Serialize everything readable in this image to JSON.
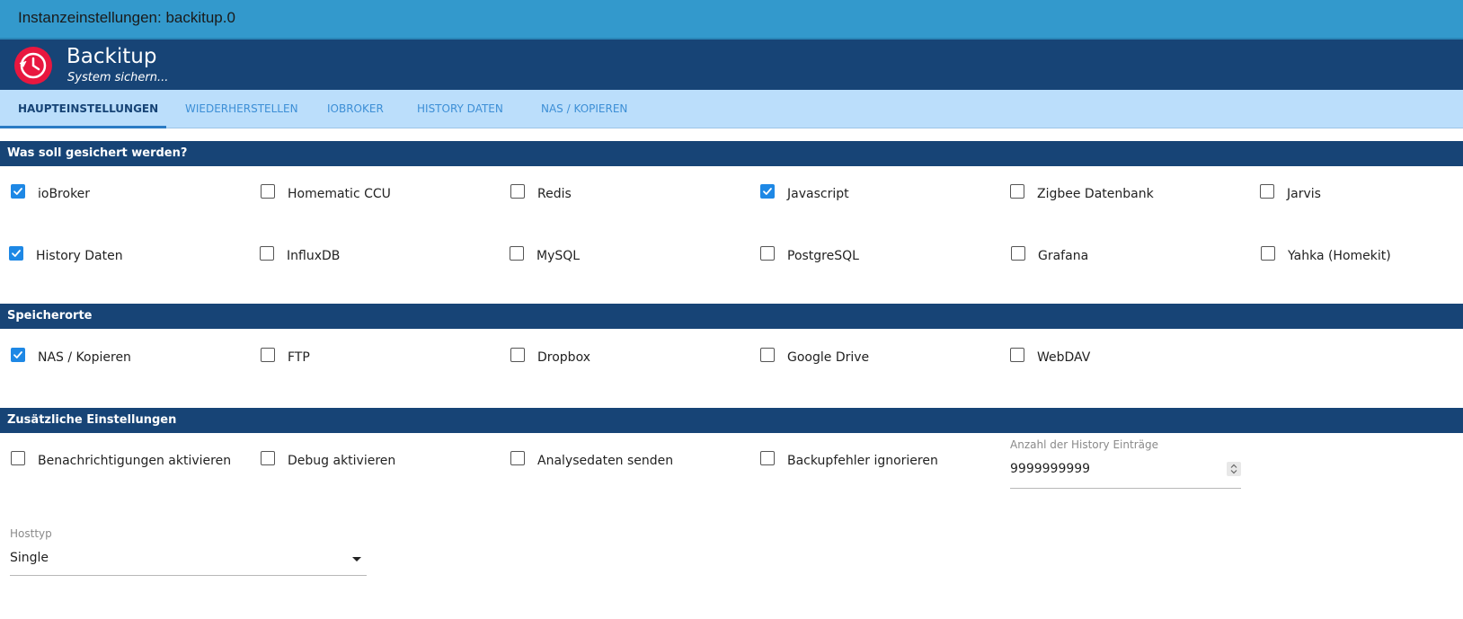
{
  "window": {
    "title": "Instanzeinstellungen: backitup.0"
  },
  "app": {
    "name": "Backitup",
    "subtitle": "System sichern..."
  },
  "tabs": [
    {
      "label": "HAUPTEINSTELLUNGEN"
    },
    {
      "label": "WIEDERHERSTELLEN"
    },
    {
      "label": "IOBROKER"
    },
    {
      "label": "HISTORY DATEN"
    },
    {
      "label": "NAS / KOPIEREN"
    }
  ],
  "sections": {
    "backup": {
      "title": "Was soll gesichert werden?"
    },
    "storage": {
      "title": "Speicherorte"
    },
    "additional": {
      "title": "Zusätzliche Einstellungen"
    }
  },
  "backup_items": [
    {
      "label": "ioBroker",
      "checked": true
    },
    {
      "label": "Homematic CCU",
      "checked": false
    },
    {
      "label": "Redis",
      "checked": false
    },
    {
      "label": "Javascript",
      "checked": true
    },
    {
      "label": "Zigbee Datenbank",
      "checked": false
    },
    {
      "label": "Jarvis",
      "checked": false
    },
    {
      "label": "History Daten",
      "checked": true
    },
    {
      "label": "InfluxDB",
      "checked": false
    },
    {
      "label": "MySQL",
      "checked": false
    },
    {
      "label": "PostgreSQL",
      "checked": false
    },
    {
      "label": "Grafana",
      "checked": false
    },
    {
      "label": "Yahka (Homekit)",
      "checked": false
    }
  ],
  "storage_items": [
    {
      "label": "NAS / Kopieren",
      "checked": true
    },
    {
      "label": "FTP",
      "checked": false
    },
    {
      "label": "Dropbox",
      "checked": false
    },
    {
      "label": "Google Drive",
      "checked": false
    },
    {
      "label": "WebDAV",
      "checked": false
    }
  ],
  "additional_items": [
    {
      "label": "Benachrichtigungen aktivieren",
      "checked": false
    },
    {
      "label": "Debug aktivieren",
      "checked": false
    },
    {
      "label": "Analysedaten senden",
      "checked": false
    },
    {
      "label": "Backupfehler ignorieren",
      "checked": false
    }
  ],
  "history_count": {
    "label": "Anzahl der History Einträge",
    "value": "9999999999"
  },
  "host_type": {
    "label": "Hosttyp",
    "value": "Single"
  },
  "colors": {
    "titlebar": "#3399cc",
    "header": "#174476",
    "tabbar": "#bbdefb",
    "accent": "#1e88e5",
    "logo": "#e8173f"
  }
}
